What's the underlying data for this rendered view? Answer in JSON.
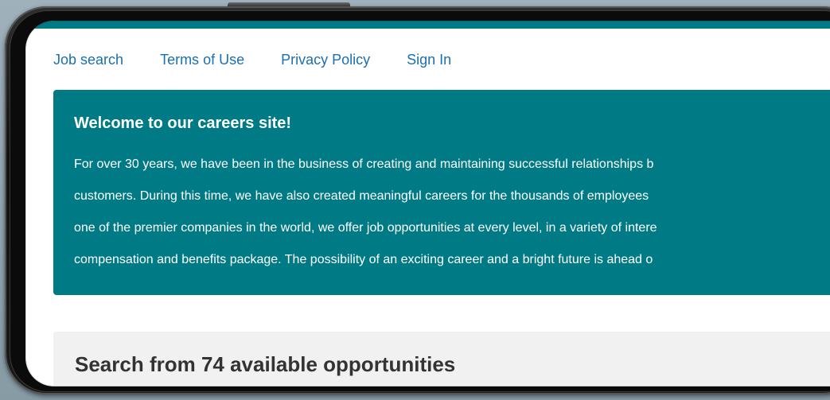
{
  "nav": {
    "items": [
      {
        "label": "Job search"
      },
      {
        "label": "Terms of Use"
      },
      {
        "label": "Privacy Policy"
      },
      {
        "label": "Sign In"
      }
    ]
  },
  "hero": {
    "title": "Welcome to our careers site!",
    "lines": [
      "For over 30 years, we have been in the business of creating and maintaining successful relationships b",
      "customers. During this time, we have also created meaningful careers for the thousands of employees",
      "one of the premier companies in the world, we offer job opportunities at every level, in a variety of intere",
      "compensation and benefits package. The possibility of an exciting career and a bright future is ahead o"
    ]
  },
  "search": {
    "title": "Search from 74 available opportunities"
  },
  "colors": {
    "brand_teal": "#007a85",
    "link_blue": "#1a6fb0",
    "panel_gray": "#f1f1f1"
  }
}
